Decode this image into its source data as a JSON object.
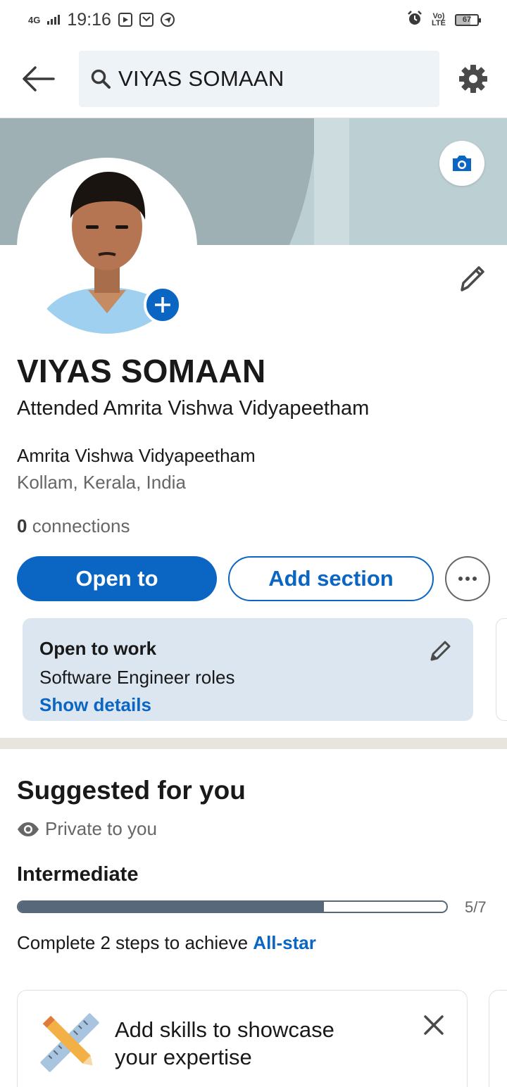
{
  "status_bar": {
    "network": "4G",
    "time": "19:16",
    "volte": "Vo) LTE",
    "battery": "67"
  },
  "search": {
    "query": "VIYAS SOMAAN"
  },
  "profile": {
    "name": "VIYAS SOMAAN",
    "headline": "Attended Amrita Vishwa Vidyapeetham",
    "school": "Amrita Vishwa Vidyapeetham",
    "location": "Kollam, Kerala, India",
    "connections_count": "0",
    "connections_label": " connections"
  },
  "actions": {
    "open_to": "Open to",
    "add_section": "Add section"
  },
  "open_to_work": {
    "title": "Open to work",
    "roles": "Software Engineer roles",
    "link": "Show details"
  },
  "suggested": {
    "title": "Suggested for you",
    "privacy": "Private to you",
    "level": "Intermediate",
    "progress_label": "5/7",
    "progress_fraction": 0.714,
    "steps_prefix": "Complete 2 steps to achieve ",
    "steps_highlight": "All-star"
  },
  "skill_card": {
    "text": "Add skills to showcase your expertise"
  },
  "colors": {
    "brand_blue": "#0a66c2",
    "progress": "#56687a",
    "card_bg": "#dce6f1"
  }
}
